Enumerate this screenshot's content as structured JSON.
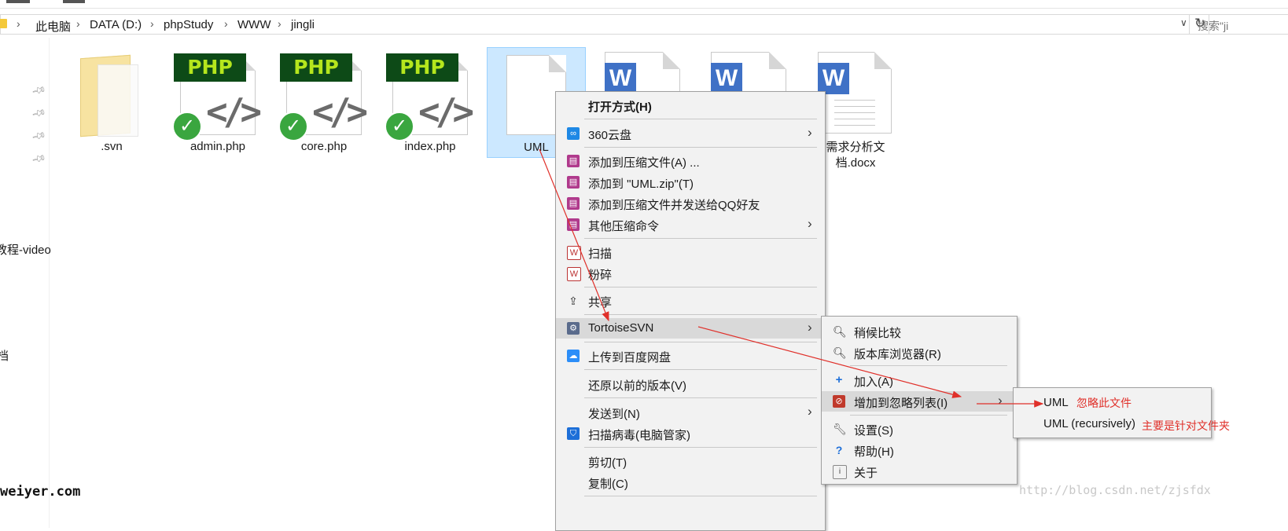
{
  "breadcrumb": {
    "items": [
      "此电脑",
      "DATA (D:)",
      "phpStudy",
      "WWW",
      "jingli"
    ],
    "search_placeholder": "搜索\"ji"
  },
  "nav_pane": {
    "items": [
      "教程-video",
      "档"
    ]
  },
  "files": [
    {
      "name": ".svn",
      "type": "folder"
    },
    {
      "name": "admin.php",
      "type": "php",
      "badge": "PHP"
    },
    {
      "name": "core.php",
      "type": "php",
      "badge": "PHP"
    },
    {
      "name": "index.php",
      "type": "php",
      "badge": "PHP"
    },
    {
      "name": "UML",
      "type": "file",
      "selected": true
    },
    {
      "name": "",
      "type": "wps"
    },
    {
      "name": "",
      "type": "wps"
    },
    {
      "name": "需求分析文档.docx",
      "type": "wps"
    }
  ],
  "context_menu": {
    "open_with": "打开方式(H)",
    "cloud_360": "360云盘",
    "add_archive": "添加到压缩文件(A) ...",
    "add_zip": "添加到 \"UML.zip\"(T)",
    "add_archive_qq": "添加到压缩文件并发送给QQ好友",
    "other_compress": "其他压缩命令",
    "scan": "扫描",
    "shred": "粉碎",
    "share": "共享",
    "tortoisesvn": "TortoiseSVN",
    "upload_baidu": "上传到百度网盘",
    "restore_prev": "还原以前的版本(V)",
    "send_to": "发送到(N)",
    "scan_virus": "扫描病毒(电脑管家)",
    "cut": "剪切(T)",
    "copy": "复制(C)"
  },
  "svn_menu": {
    "diff_later": "稍候比较",
    "repo_browser": "版本库浏览器(R)",
    "add": "加入(A)",
    "add_ignore": "增加到忽略列表(I)",
    "settings": "设置(S)",
    "help": "帮助(H)",
    "about": "关于"
  },
  "ignore_menu": {
    "uml": "UML",
    "uml_recursive": "UML (recursively)"
  },
  "annotations": {
    "ignore_file": "忽略此文件",
    "for_folder": "主要是针对文件夹"
  },
  "watermarks": {
    "left": "weiyer.com",
    "right": "http://blog.csdn.net/zjsfdx"
  },
  "colors": {
    "selection": "#cce8ff",
    "menu_bg": "#f2f2f2",
    "annotation_red": "#e0302a",
    "php_badge": "#0d4a17",
    "wps_blue": "#3f71c6"
  }
}
